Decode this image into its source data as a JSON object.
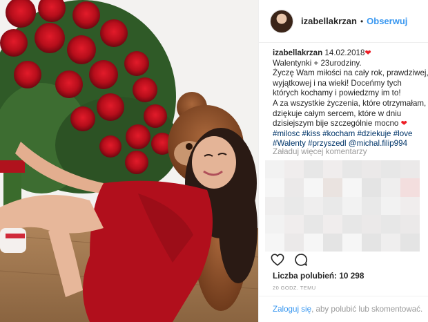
{
  "post": {
    "username": "izabellakrzan",
    "follow_label": "Obserwuj",
    "separator": "•"
  },
  "caption": {
    "username": "izabellakrzan",
    "date": "14.02.2018",
    "lines": [
      "Walentynki + 23urodziny.",
      "Życzę Wam miłości na cały rok, prawdziwej,",
      "wyjątkowej i na wieki! Doceńmy tych",
      "których kochamy i powiedzmy im to!",
      "A za wszystkie życzenia, które otrzymałam,",
      "dziękuje całym sercem, które w dniu",
      "dzisiejszym bije szczególnie mocno"
    ],
    "hashtags_line1": [
      "#milosc",
      "#kiss",
      "#kocham",
      "#dziekuje",
      "#love"
    ],
    "hashtags_line2": [
      "#Walenty",
      "#przyszedl"
    ],
    "mention": "@michal.filip994",
    "heart_glyph": "❤",
    "heart_color": "#ed1c24"
  },
  "comments": {
    "load_more_label": "Załaduj więcej komentarzy"
  },
  "actions": {
    "like_icon": "heart-outline-icon",
    "comment_icon": "comment-bubble-icon"
  },
  "likes": {
    "label": "Liczba polubień: 10 298"
  },
  "timestamp": {
    "label": "20 GODZ. TEMU"
  },
  "login": {
    "link_label": "Zaloguj się",
    "rest_label": ", aby polubić lub skomentować."
  },
  "colors": {
    "accent_blue": "#3897f0",
    "hashtag_blue": "#003569",
    "muted_gray": "#999999",
    "text": "#262626"
  }
}
